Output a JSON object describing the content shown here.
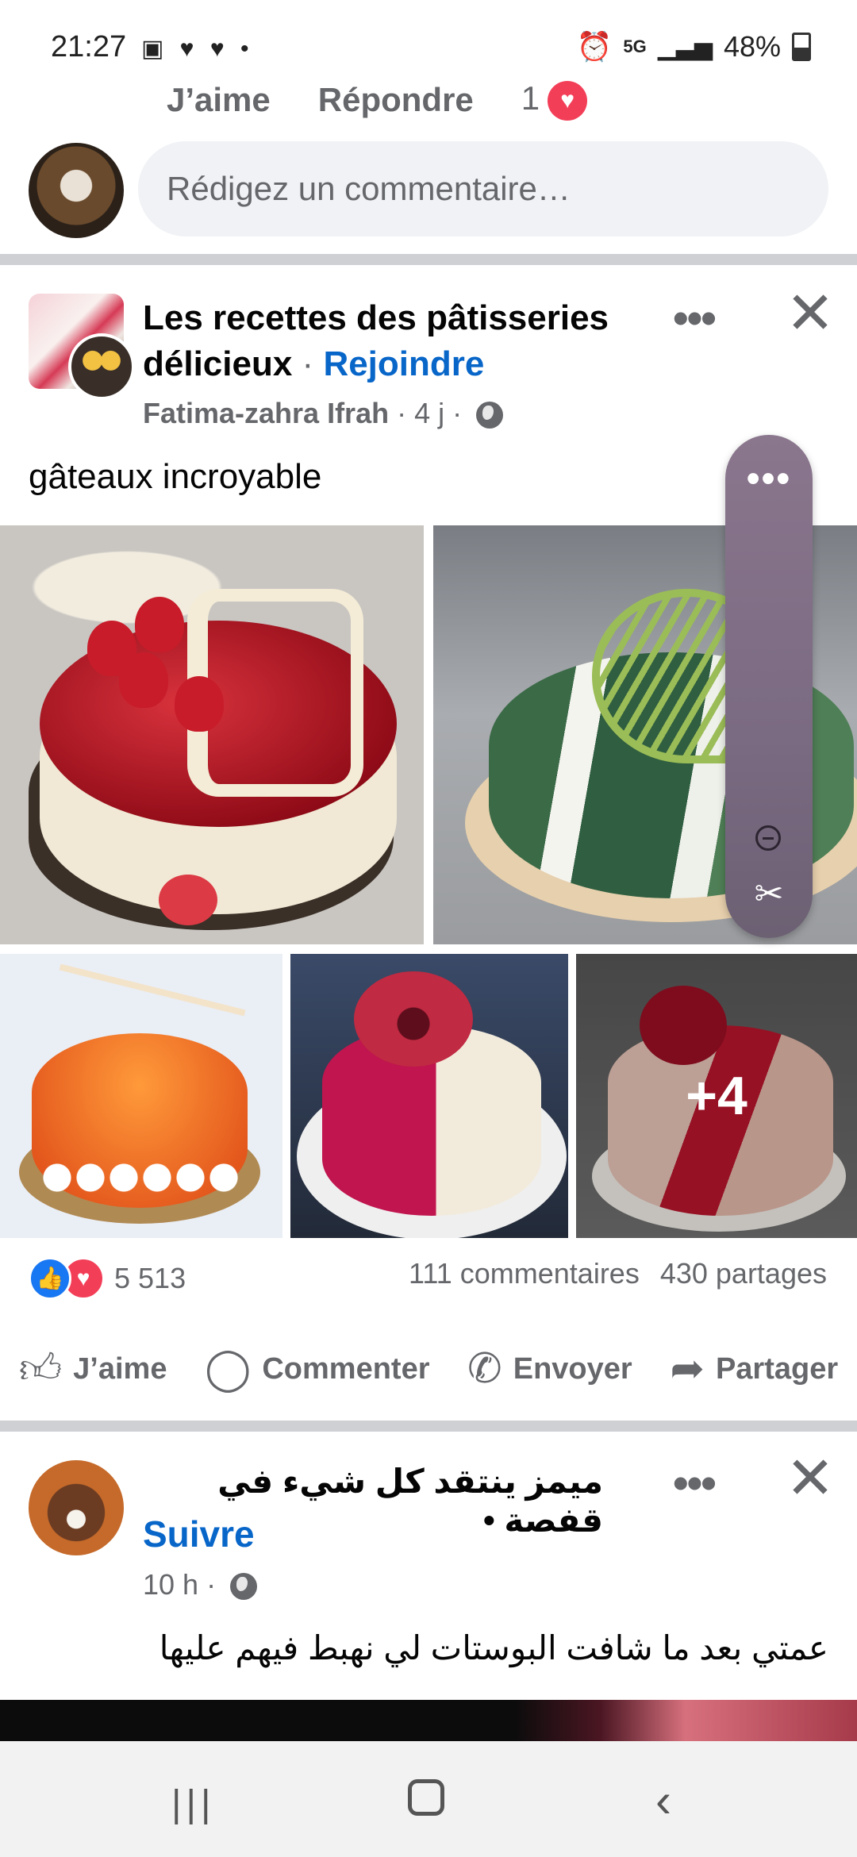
{
  "status_bar": {
    "time": "21:27",
    "left_icons": "▣ ♥ ♥ •",
    "network": "5G",
    "battery": "48%"
  },
  "comment_actions": {
    "like": "J’aime",
    "reply": "Répondre",
    "reaction_count": "1"
  },
  "comment_input": {
    "placeholder": "Rédigez un commentaire…"
  },
  "post1": {
    "group_name": "Les recettes des pâtisseries délicieux",
    "separator": "·",
    "join_label": "Rejoindre",
    "author": "Fatima-zahra Ifrah",
    "time": "4 j",
    "more_icon": "•••",
    "close_icon": "✕",
    "text": "gâteaux incroyable",
    "more_photos": "+4",
    "reaction_count": "5 513",
    "comments": "111 commentaires",
    "shares": "430 partages",
    "actions": {
      "like": "J’aime",
      "comment": "Commenter",
      "send": "Envoyer",
      "share": "Partager"
    }
  },
  "bubble": {
    "more_icon": "•••"
  },
  "post2": {
    "name": "ميمز ينتقد كل شيء في قفصة",
    "bullet": "•",
    "follow_label": "Suivre",
    "time": "10 h",
    "text": "عمتي بعد ما شافت البوستات لي نهبط فيهم عليها"
  },
  "navbar": {
    "recents": "|||",
    "back": "‹"
  },
  "colors": {
    "link_blue": "#0866c9",
    "like_blue": "#1877f2",
    "love_red": "#f33e58",
    "secondary_text": "#65676b"
  }
}
